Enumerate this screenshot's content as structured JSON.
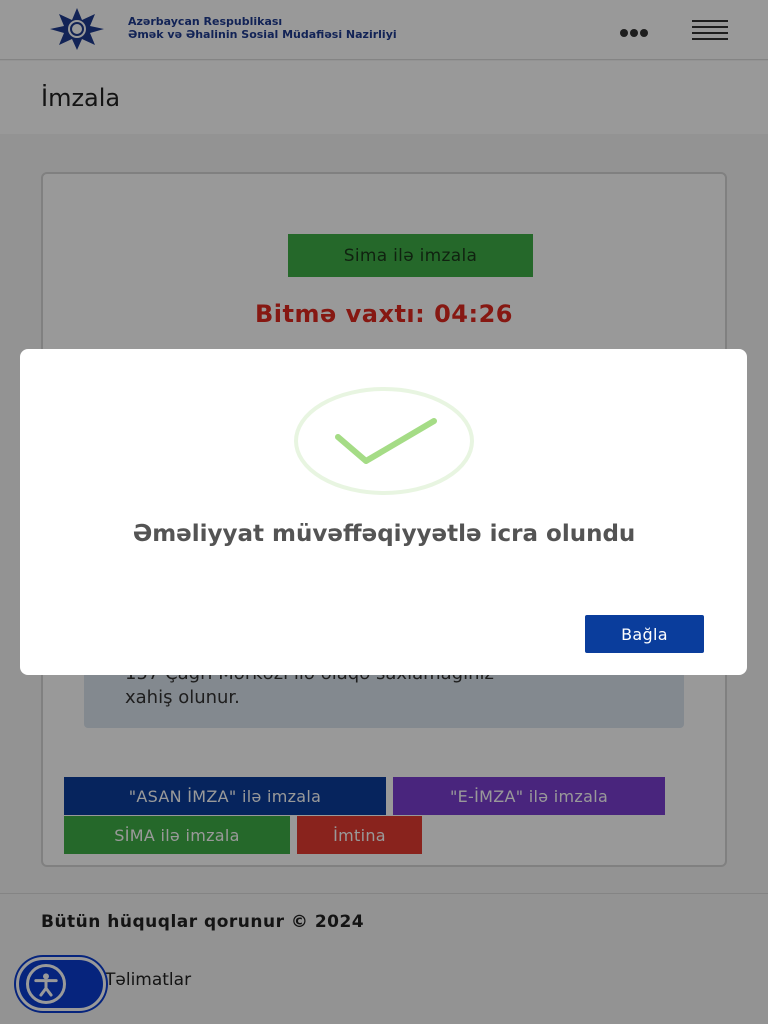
{
  "header": {
    "org_line1": "Azərbaycan Respublikası",
    "org_line2": "Əmək və Əhalinin Sosial Müdafiəsi Nazirliyi",
    "logo_icon": "ministry-star-emblem",
    "more_icon": "more-dots-icon",
    "menu_icon": "hamburger-menu-icon"
  },
  "page": {
    "title": "İmzala"
  },
  "card": {
    "sima_button": "Sima ilə imzala",
    "timer_label": "Bitmə vaxtı: 04:26",
    "info_line1": "157 Çağrı Mərkəzi ilə əlaqə saxlamağınız",
    "info_line2": "xahiş olunur.",
    "buttons": {
      "asan": "\"ASAN İMZA\" ilə imzala",
      "eimza": "\"E-İMZA\" ilə imzala",
      "sima": "SİMA ilə imzala",
      "imtina": "İmtina"
    }
  },
  "footer": {
    "copyright": "Bütün hüquqlar qorunur © 2024",
    "help_link": "Təlimatlar"
  },
  "modal": {
    "message": "Əməliyyat müvəffəqiyyətlə icra olundu",
    "close_button": "Bağla",
    "success_icon": "success-check-icon"
  },
  "colors": {
    "primary_blue": "#0a3d9c",
    "green": "#3eae46",
    "purple": "#7a3fd1",
    "red": "#e53b31",
    "timer_red": "#e0281f",
    "success_green": "#a5dc86"
  }
}
